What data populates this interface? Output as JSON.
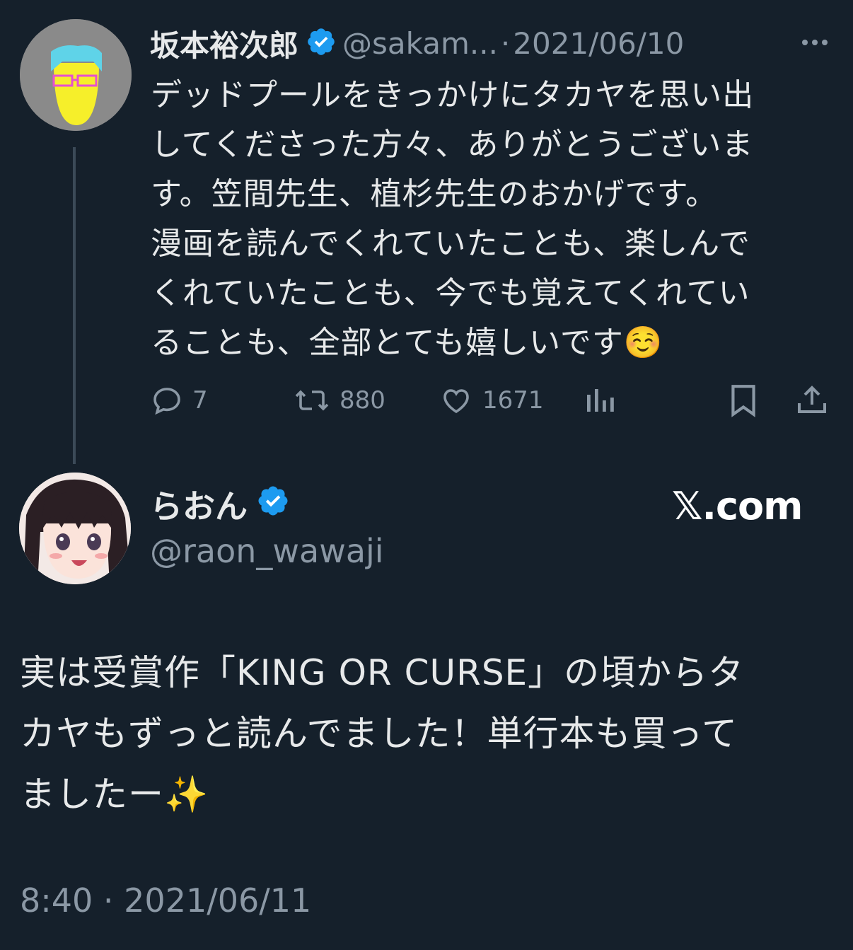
{
  "parent_tweet": {
    "display_name": "坂本裕次郎",
    "handle": "@sakam...",
    "separator": "·",
    "date": "2021/06/10",
    "text": "デッドプールをきっかけにタカヤを思い出\nしてくださった方々、ありがとうございま\nす。笠間先生、植杉先生のおかげです。\n漫画を読んでくれていたことも、楽しんで\nくれていたことも、今でも覚えてくれてい\nることも、全部とても嬉しいです☺️",
    "metrics": {
      "replies": "7",
      "retweets": "880",
      "likes": "1671"
    },
    "icons": [
      "verified-badge-icon",
      "more-icon",
      "reply-icon",
      "retweet-icon",
      "like-icon",
      "views-icon",
      "bookmark-icon",
      "share-icon"
    ]
  },
  "reply_tweet": {
    "display_name": "らおん",
    "handle": "@raon_wawaji",
    "brand": "𝕏.com",
    "text": "実は受賞作「KING OR CURSE」の頃からタ\nカヤもずっと読んでました！単行本も買って\nましたー✨",
    "timestamp": "8:40 · 2021/06/11"
  },
  "colors": {
    "background": "#15202b",
    "text_primary": "#e7e9ea",
    "text_secondary": "#8b98a5",
    "verified": "#1d9bf0"
  }
}
